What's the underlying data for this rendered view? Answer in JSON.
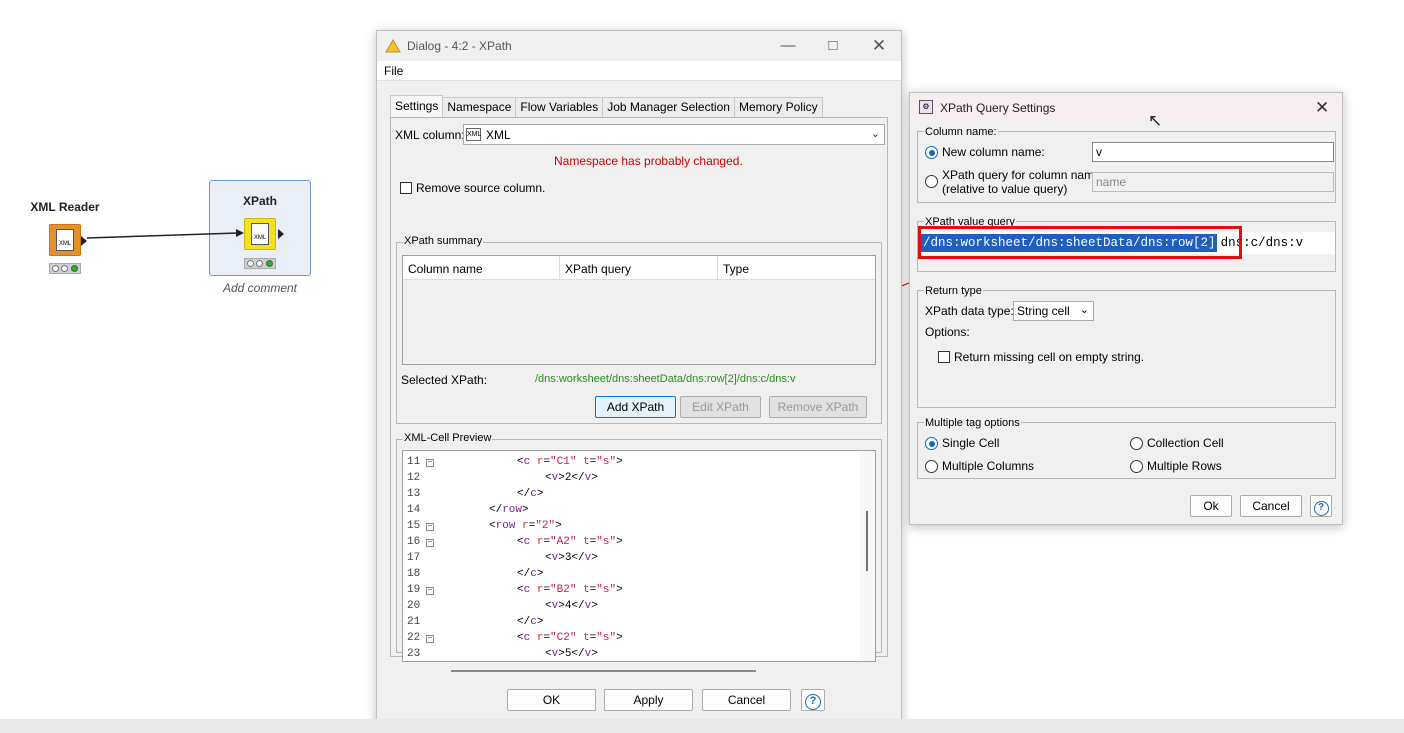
{
  "workflow": {
    "xml_reader": {
      "title": "XML Reader",
      "icon": "xml-file-icon"
    },
    "xpath_node": {
      "title": "XPath",
      "icon": "magnifier-icon",
      "comment": "Add comment"
    },
    "node_icon_text": "XML"
  },
  "dialog": {
    "title": "Dialog - 4:2 - XPath",
    "menu": "File",
    "tabs": [
      "Settings",
      "Namespace",
      "Flow Variables",
      "Job Manager Selection",
      "Memory Policy"
    ],
    "xml_column_label": "XML column:",
    "xml_column_value": "XML",
    "warning": "Namespace has probably changed.",
    "remove_source_label": "Remove source column.",
    "summary_group": "XPath summary",
    "summary_columns": [
      "Column name",
      "XPath query",
      "Type"
    ],
    "selected_label": "Selected XPath:",
    "selected_value": "/dns:worksheet/dns:sheetData/dns:row[2]/dns:c/dns:v",
    "add_btn": "Add XPath",
    "edit_btn": "Edit XPath",
    "remove_btn": "Remove XPath",
    "preview_group": "XML-Cell Preview",
    "code_lines": [
      {
        "n": "11",
        "fold": true,
        "indent": 3,
        "parts": [
          [
            "t",
            "<"
          ],
          [
            "k",
            "c"
          ],
          [
            "t",
            " "
          ],
          [
            "a",
            "r"
          ],
          [
            "t",
            "="
          ],
          [
            "s",
            "\"C1\""
          ],
          [
            "t",
            " "
          ],
          [
            "a",
            "t"
          ],
          [
            "t",
            "="
          ],
          [
            "s",
            "\"s\""
          ],
          [
            "t",
            ">"
          ]
        ]
      },
      {
        "n": "12",
        "fold": false,
        "indent": 4,
        "parts": [
          [
            "t",
            "<"
          ],
          [
            "k",
            "v"
          ],
          [
            "t",
            ">2</"
          ],
          [
            "k",
            "v"
          ],
          [
            "t",
            ">"
          ]
        ]
      },
      {
        "n": "13",
        "fold": false,
        "indent": 3,
        "parts": [
          [
            "t",
            "</"
          ],
          [
            "k",
            "c"
          ],
          [
            "t",
            ">"
          ]
        ]
      },
      {
        "n": "14",
        "fold": false,
        "indent": 2,
        "parts": [
          [
            "t",
            "</"
          ],
          [
            "k",
            "row"
          ],
          [
            "t",
            ">"
          ]
        ]
      },
      {
        "n": "15",
        "fold": true,
        "indent": 2,
        "parts": [
          [
            "t",
            "<"
          ],
          [
            "k",
            "row"
          ],
          [
            "t",
            " "
          ],
          [
            "a",
            "r"
          ],
          [
            "t",
            "="
          ],
          [
            "s",
            "\"2\""
          ],
          [
            "t",
            ">"
          ]
        ]
      },
      {
        "n": "16",
        "fold": true,
        "indent": 3,
        "parts": [
          [
            "t",
            "<"
          ],
          [
            "k",
            "c"
          ],
          [
            "t",
            " "
          ],
          [
            "a",
            "r"
          ],
          [
            "t",
            "="
          ],
          [
            "s",
            "\"A2\""
          ],
          [
            "t",
            " "
          ],
          [
            "a",
            "t"
          ],
          [
            "t",
            "="
          ],
          [
            "s",
            "\"s\""
          ],
          [
            "t",
            ">"
          ]
        ]
      },
      {
        "n": "17",
        "fold": false,
        "indent": 4,
        "parts": [
          [
            "t",
            "<"
          ],
          [
            "k",
            "v"
          ],
          [
            "t",
            ">3</"
          ],
          [
            "k",
            "v"
          ],
          [
            "t",
            ">"
          ]
        ]
      },
      {
        "n": "18",
        "fold": false,
        "indent": 3,
        "parts": [
          [
            "t",
            "</"
          ],
          [
            "k",
            "c"
          ],
          [
            "t",
            ">"
          ]
        ]
      },
      {
        "n": "19",
        "fold": true,
        "indent": 3,
        "parts": [
          [
            "t",
            "<"
          ],
          [
            "k",
            "c"
          ],
          [
            "t",
            " "
          ],
          [
            "a",
            "r"
          ],
          [
            "t",
            "="
          ],
          [
            "s",
            "\"B2\""
          ],
          [
            "t",
            " "
          ],
          [
            "a",
            "t"
          ],
          [
            "t",
            "="
          ],
          [
            "s",
            "\"s\""
          ],
          [
            "t",
            ">"
          ]
        ]
      },
      {
        "n": "20",
        "fold": false,
        "indent": 4,
        "parts": [
          [
            "t",
            "<"
          ],
          [
            "k",
            "v"
          ],
          [
            "t",
            ">4</"
          ],
          [
            "k",
            "v"
          ],
          [
            "t",
            ">"
          ]
        ]
      },
      {
        "n": "21",
        "fold": false,
        "indent": 3,
        "parts": [
          [
            "t",
            "</"
          ],
          [
            "k",
            "c"
          ],
          [
            "t",
            ">"
          ]
        ]
      },
      {
        "n": "22",
        "fold": true,
        "indent": 3,
        "parts": [
          [
            "t",
            "<"
          ],
          [
            "k",
            "c"
          ],
          [
            "t",
            " "
          ],
          [
            "a",
            "r"
          ],
          [
            "t",
            "="
          ],
          [
            "s",
            "\"C2\""
          ],
          [
            "t",
            " "
          ],
          [
            "a",
            "t"
          ],
          [
            "t",
            "="
          ],
          [
            "s",
            "\"s\""
          ],
          [
            "t",
            ">"
          ]
        ]
      },
      {
        "n": "23",
        "fold": false,
        "indent": 4,
        "parts": [
          [
            "t",
            "<"
          ],
          [
            "k",
            "v"
          ],
          [
            "t",
            ">5</"
          ],
          [
            "k",
            "v"
          ],
          [
            "t",
            ">"
          ]
        ]
      }
    ],
    "ok_btn": "OK",
    "apply_btn": "Apply",
    "cancel_btn": "Cancel",
    "help_btn": "?"
  },
  "settings": {
    "title": "XPath Query Settings",
    "column_group": "Column name:",
    "new_column_label": "New column name:",
    "new_column_value": "v",
    "xpath_col_label_1": "XPath query for column name:",
    "xpath_col_label_2": "(relative to value query)",
    "xpath_col_placeholder": "name",
    "value_group": "XPath value query",
    "value_selected": "/dns:worksheet/dns:sheetData/dns:row[2]",
    "value_rest": "dns:c/dns:v",
    "return_group": "Return type",
    "datatype_label": "XPath data type:",
    "datatype_value": "String cell",
    "options_label": "Options:",
    "missing_label": "Return missing cell on empty string.",
    "multi_group": "Multiple tag options",
    "single_cell": "Single Cell",
    "collection_cell": "Collection Cell",
    "multi_columns": "Multiple Columns",
    "multi_rows": "Multiple Rows",
    "ok_btn": "Ok",
    "cancel_btn": "Cancel",
    "help_btn": "?"
  },
  "colors": {
    "highlight": "#1f5fbf",
    "annotation": "#e01010",
    "warning": "#cc0000",
    "green_text": "#2e8b22"
  }
}
